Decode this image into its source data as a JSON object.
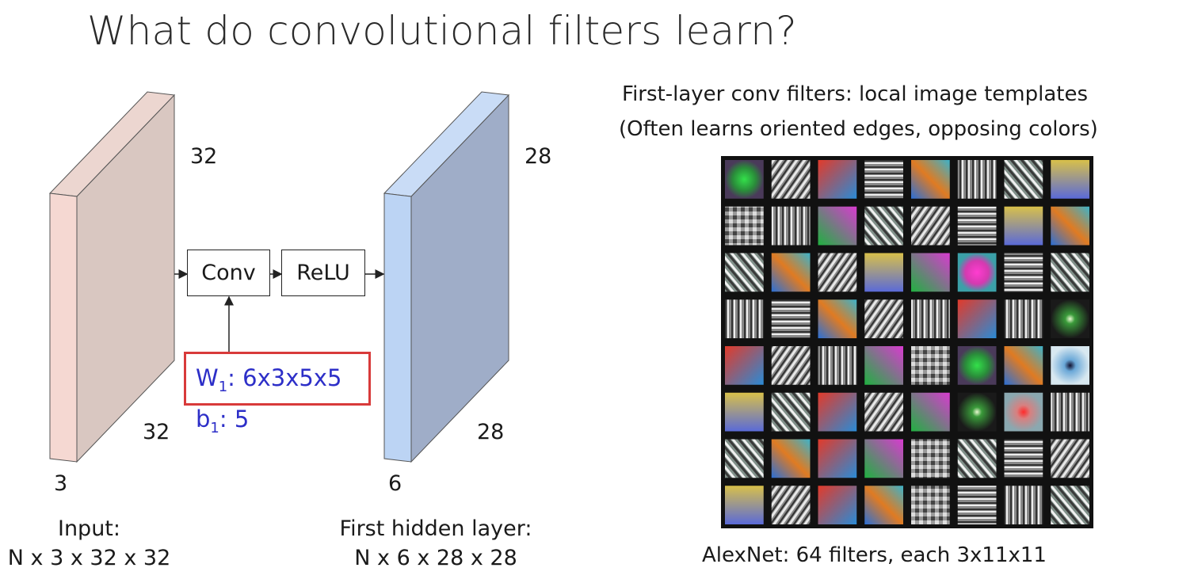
{
  "title": "What do convolutional filters learn?",
  "input_volume": {
    "height": "32",
    "width": "32",
    "depth": "3"
  },
  "hidden_volume": {
    "height": "28",
    "width": "28",
    "depth": "6"
  },
  "ops": {
    "conv": "Conv",
    "relu": "ReLU"
  },
  "params": {
    "w_main": "W",
    "w_sub": "1",
    "w_rest": ": 6x3x5x5",
    "b_main": "b",
    "b_sub": "1",
    "b_rest": ": 5"
  },
  "input_caption": {
    "line1": "Input:",
    "line2": "N x 3 x 32 x 32"
  },
  "hidden_caption": {
    "line1": "First hidden layer:",
    "line2": "N x 6 x 28 x 28"
  },
  "filters_heading": {
    "line1": "First-layer conv filters: local image templates",
    "line2": "(Often learns oriented edges, opposing colors)"
  },
  "filters_caption": "AlexNet: 64 filters, each 3x11x11",
  "colors": {
    "input_front": "#f5d8d2",
    "input_side": "#d9c7c1",
    "input_top": "#ecd6d0",
    "hidden_front": "#bcd4f4",
    "hidden_side": "#9fadc8",
    "hidden_top": "#c9dcf6",
    "param_blue": "#2d2fc8",
    "param_border": "#d83a3a"
  }
}
